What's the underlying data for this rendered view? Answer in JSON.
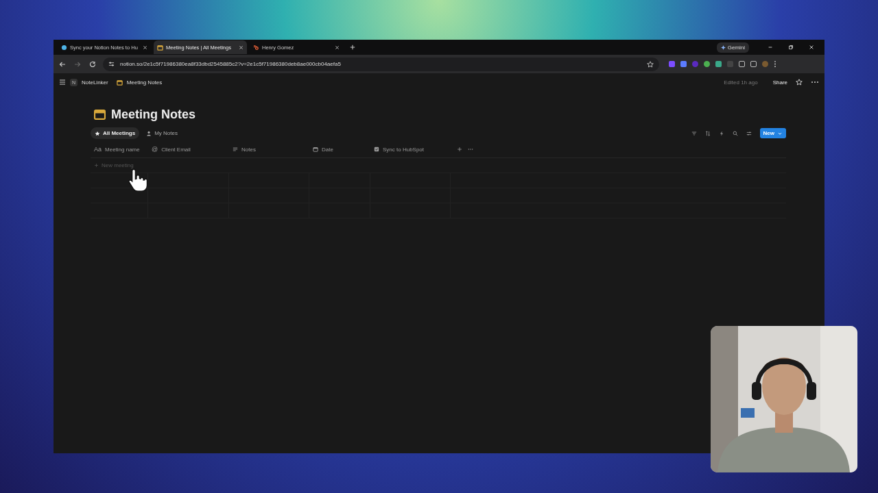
{
  "browser": {
    "tabs": [
      {
        "title": "Sync your Notion Notes to Hu",
        "selected": false
      },
      {
        "title": "Meeting Notes | All Meetings",
        "selected": true
      },
      {
        "title": "Henry Gomez",
        "selected": false
      }
    ],
    "gemini": "Gemini",
    "url": "notion.so/2e1c5f71986380ea8f33dbd2545885c2?v=2e1c5f71986380deb8ae000cb04aefa5"
  },
  "topbar": {
    "workspace_initial": "N",
    "workspace": "NoteLinker",
    "page": "Meeting Notes",
    "edited": "Edited 1h ago",
    "share": "Share"
  },
  "title": "Meeting Notes",
  "views": [
    {
      "label": "All Meetings",
      "selected": true
    },
    {
      "label": "My Notes",
      "selected": false
    }
  ],
  "new_button": "New",
  "table": {
    "columns": [
      {
        "name": "Meeting name",
        "icon_text": "Aa"
      },
      {
        "name": "Client Email",
        "icon_text": "@"
      },
      {
        "name": "Notes"
      },
      {
        "name": "Date"
      },
      {
        "name": "Sync to HubSpot"
      }
    ],
    "new_row": "New meeting"
  }
}
